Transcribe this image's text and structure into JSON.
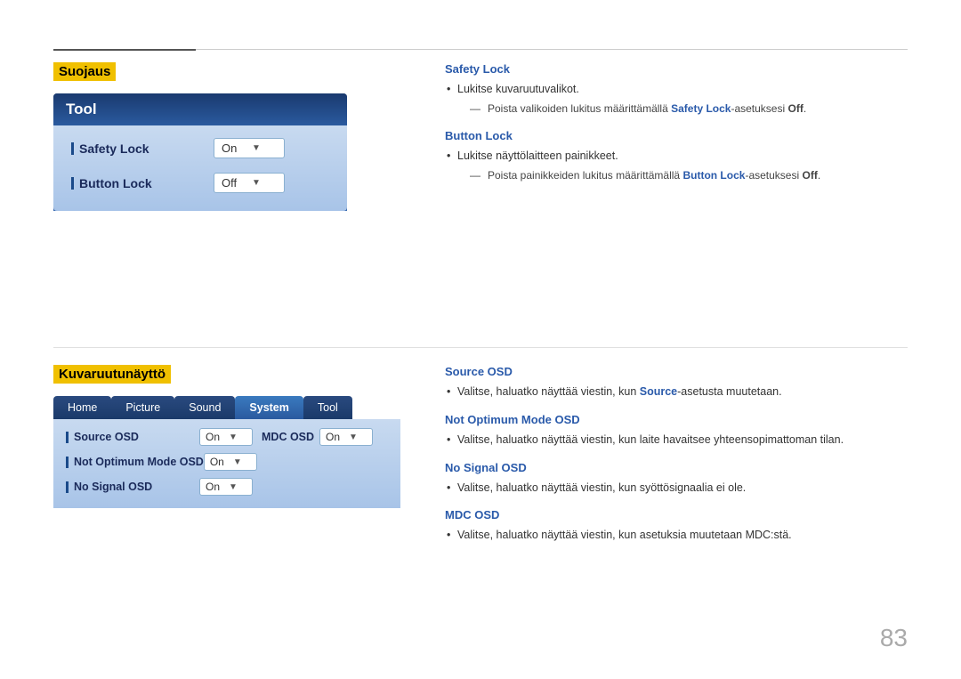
{
  "topLine": {},
  "suojaus": {
    "title": "Suojaus",
    "tool": {
      "header": "Tool",
      "rows": [
        {
          "label": "Safety Lock",
          "value": "On"
        },
        {
          "label": "Button Lock",
          "value": "Off"
        }
      ]
    },
    "descriptions": {
      "safetyLock": {
        "title": "Safety Lock",
        "bullets": [
          "Lukitse kuvaruutuvalikot."
        ],
        "sub": "Poista valikoiden lukitus määrittämällä Safety Lock-asetuksesi Off."
      },
      "buttonLock": {
        "title": "Button Lock",
        "bullets": [
          "Lukitse näyttölaitteen painikkeet."
        ],
        "sub": "Poista painikkeiden lukitus määrittämällä Button Lock-asetuksesi Off."
      }
    }
  },
  "kuvaruutu": {
    "title": "Kuvaruutunäyttö",
    "tabs": [
      {
        "label": "Home",
        "active": false
      },
      {
        "label": "Picture",
        "active": false
      },
      {
        "label": "Sound",
        "active": false
      },
      {
        "label": "System",
        "active": true
      },
      {
        "label": "Tool",
        "active": false
      }
    ],
    "rows": [
      {
        "label": "Source OSD",
        "value": "On",
        "second_label": "MDC OSD",
        "second_value": "On"
      },
      {
        "label": "Not Optimum Mode OSD",
        "value": "On",
        "second_label": null,
        "second_value": null
      },
      {
        "label": "No Signal OSD",
        "value": "On",
        "second_label": null,
        "second_value": null
      }
    ],
    "descriptions": {
      "sourceOSD": {
        "title": "Source OSD",
        "bullets": [
          "Valitse, haluatko näyttää viestin, kun Source-asetusta muutetaan."
        ]
      },
      "notOptimumModeOSD": {
        "title": "Not Optimum Mode OSD",
        "bullets": [
          "Valitse, haluatko näyttää viestin, kun laite havaitsee yhteensopimattoman tilan."
        ]
      },
      "noSignalOSD": {
        "title": "No Signal OSD",
        "bullets": [
          "Valitse, haluatko näyttää viestin, kun syöttösignaalia ei ole."
        ]
      },
      "mdcOSD": {
        "title": "MDC OSD",
        "bullets": [
          "Valitse, haluatko näyttää viestin, kun asetuksia muutetaan MDC:stä."
        ]
      }
    }
  },
  "pageNumber": "83"
}
